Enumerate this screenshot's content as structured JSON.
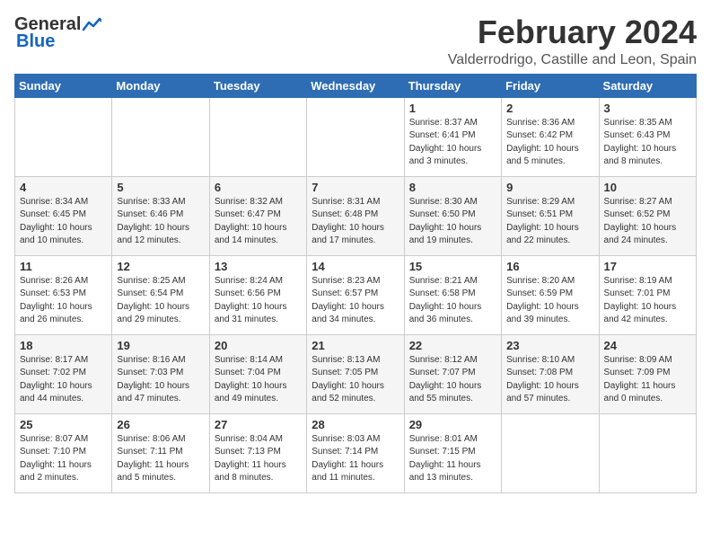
{
  "header": {
    "logo_general": "General",
    "logo_blue": "Blue",
    "month": "February 2024",
    "location": "Valderrodrigo, Castille and Leon, Spain"
  },
  "weekdays": [
    "Sunday",
    "Monday",
    "Tuesday",
    "Wednesday",
    "Thursday",
    "Friday",
    "Saturday"
  ],
  "weeks": [
    {
      "days": [
        {
          "num": "",
          "info": ""
        },
        {
          "num": "",
          "info": ""
        },
        {
          "num": "",
          "info": ""
        },
        {
          "num": "",
          "info": ""
        },
        {
          "num": "1",
          "info": "Sunrise: 8:37 AM\nSunset: 6:41 PM\nDaylight: 10 hours\nand 3 minutes."
        },
        {
          "num": "2",
          "info": "Sunrise: 8:36 AM\nSunset: 6:42 PM\nDaylight: 10 hours\nand 5 minutes."
        },
        {
          "num": "3",
          "info": "Sunrise: 8:35 AM\nSunset: 6:43 PM\nDaylight: 10 hours\nand 8 minutes."
        }
      ]
    },
    {
      "days": [
        {
          "num": "4",
          "info": "Sunrise: 8:34 AM\nSunset: 6:45 PM\nDaylight: 10 hours\nand 10 minutes."
        },
        {
          "num": "5",
          "info": "Sunrise: 8:33 AM\nSunset: 6:46 PM\nDaylight: 10 hours\nand 12 minutes."
        },
        {
          "num": "6",
          "info": "Sunrise: 8:32 AM\nSunset: 6:47 PM\nDaylight: 10 hours\nand 14 minutes."
        },
        {
          "num": "7",
          "info": "Sunrise: 8:31 AM\nSunset: 6:48 PM\nDaylight: 10 hours\nand 17 minutes."
        },
        {
          "num": "8",
          "info": "Sunrise: 8:30 AM\nSunset: 6:50 PM\nDaylight: 10 hours\nand 19 minutes."
        },
        {
          "num": "9",
          "info": "Sunrise: 8:29 AM\nSunset: 6:51 PM\nDaylight: 10 hours\nand 22 minutes."
        },
        {
          "num": "10",
          "info": "Sunrise: 8:27 AM\nSunset: 6:52 PM\nDaylight: 10 hours\nand 24 minutes."
        }
      ]
    },
    {
      "days": [
        {
          "num": "11",
          "info": "Sunrise: 8:26 AM\nSunset: 6:53 PM\nDaylight: 10 hours\nand 26 minutes."
        },
        {
          "num": "12",
          "info": "Sunrise: 8:25 AM\nSunset: 6:54 PM\nDaylight: 10 hours\nand 29 minutes."
        },
        {
          "num": "13",
          "info": "Sunrise: 8:24 AM\nSunset: 6:56 PM\nDaylight: 10 hours\nand 31 minutes."
        },
        {
          "num": "14",
          "info": "Sunrise: 8:23 AM\nSunset: 6:57 PM\nDaylight: 10 hours\nand 34 minutes."
        },
        {
          "num": "15",
          "info": "Sunrise: 8:21 AM\nSunset: 6:58 PM\nDaylight: 10 hours\nand 36 minutes."
        },
        {
          "num": "16",
          "info": "Sunrise: 8:20 AM\nSunset: 6:59 PM\nDaylight: 10 hours\nand 39 minutes."
        },
        {
          "num": "17",
          "info": "Sunrise: 8:19 AM\nSunset: 7:01 PM\nDaylight: 10 hours\nand 42 minutes."
        }
      ]
    },
    {
      "days": [
        {
          "num": "18",
          "info": "Sunrise: 8:17 AM\nSunset: 7:02 PM\nDaylight: 10 hours\nand 44 minutes."
        },
        {
          "num": "19",
          "info": "Sunrise: 8:16 AM\nSunset: 7:03 PM\nDaylight: 10 hours\nand 47 minutes."
        },
        {
          "num": "20",
          "info": "Sunrise: 8:14 AM\nSunset: 7:04 PM\nDaylight: 10 hours\nand 49 minutes."
        },
        {
          "num": "21",
          "info": "Sunrise: 8:13 AM\nSunset: 7:05 PM\nDaylight: 10 hours\nand 52 minutes."
        },
        {
          "num": "22",
          "info": "Sunrise: 8:12 AM\nSunset: 7:07 PM\nDaylight: 10 hours\nand 55 minutes."
        },
        {
          "num": "23",
          "info": "Sunrise: 8:10 AM\nSunset: 7:08 PM\nDaylight: 10 hours\nand 57 minutes."
        },
        {
          "num": "24",
          "info": "Sunrise: 8:09 AM\nSunset: 7:09 PM\nDaylight: 11 hours\nand 0 minutes."
        }
      ]
    },
    {
      "days": [
        {
          "num": "25",
          "info": "Sunrise: 8:07 AM\nSunset: 7:10 PM\nDaylight: 11 hours\nand 2 minutes."
        },
        {
          "num": "26",
          "info": "Sunrise: 8:06 AM\nSunset: 7:11 PM\nDaylight: 11 hours\nand 5 minutes."
        },
        {
          "num": "27",
          "info": "Sunrise: 8:04 AM\nSunset: 7:13 PM\nDaylight: 11 hours\nand 8 minutes."
        },
        {
          "num": "28",
          "info": "Sunrise: 8:03 AM\nSunset: 7:14 PM\nDaylight: 11 hours\nand 11 minutes."
        },
        {
          "num": "29",
          "info": "Sunrise: 8:01 AM\nSunset: 7:15 PM\nDaylight: 11 hours\nand 13 minutes."
        },
        {
          "num": "",
          "info": ""
        },
        {
          "num": "",
          "info": ""
        }
      ]
    }
  ]
}
